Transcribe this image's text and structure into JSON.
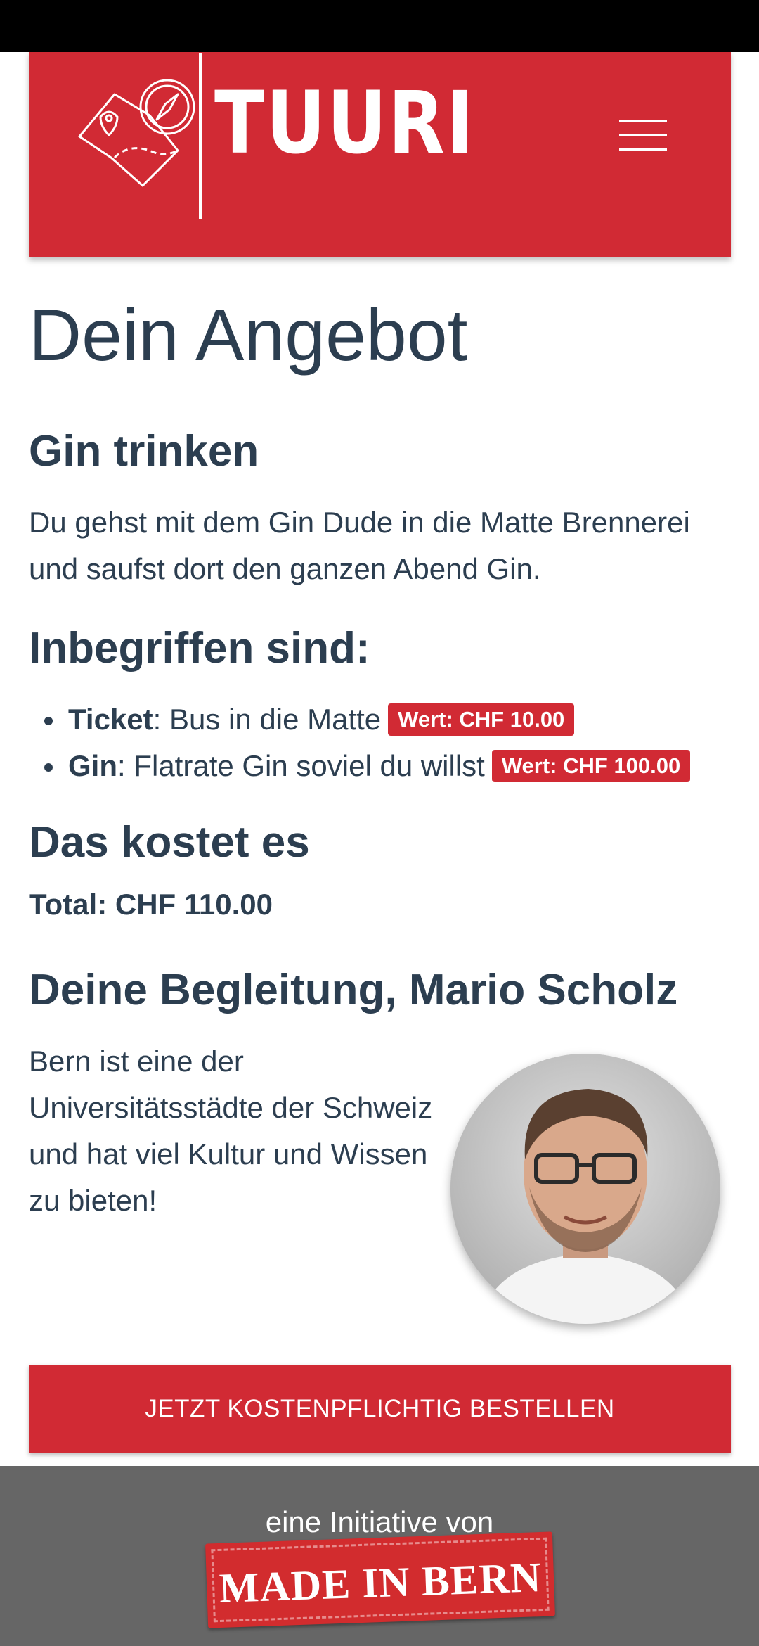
{
  "header": {
    "brand": "TUURI",
    "menu_icon": "hamburger-menu-icon",
    "color": "#d12a34"
  },
  "main": {
    "page_title": "Dein Angebot",
    "offer": {
      "title": "Gin trinken",
      "description": "Du gehst mit dem Gin Dude in die Matte Brennerei und saufst dort den ganzen Abend Gin."
    },
    "included": {
      "heading": "Inbegriffen sind:",
      "items": [
        {
          "name": "Ticket",
          "text": ": Bus in die Matte",
          "value": "Wert: CHF 10.00"
        },
        {
          "name": "Gin",
          "text": ": Flatrate Gin soviel du willst",
          "value": "Wert: CHF 100.00"
        }
      ]
    },
    "cost": {
      "heading": "Das kostet es",
      "total": "Total: CHF 110.00"
    },
    "guide": {
      "heading": "Deine Begleitung, Mario Scholz",
      "text": "Bern ist eine der Universitätsstädte der Schweiz und hat viel Kultur und Wissen zu bieten!"
    },
    "order_button": "JETZT KOSTENPFLICHTIG BESTELLEN"
  },
  "footer": {
    "text": "eine Initiative von",
    "label": "MADE IN BERN"
  }
}
